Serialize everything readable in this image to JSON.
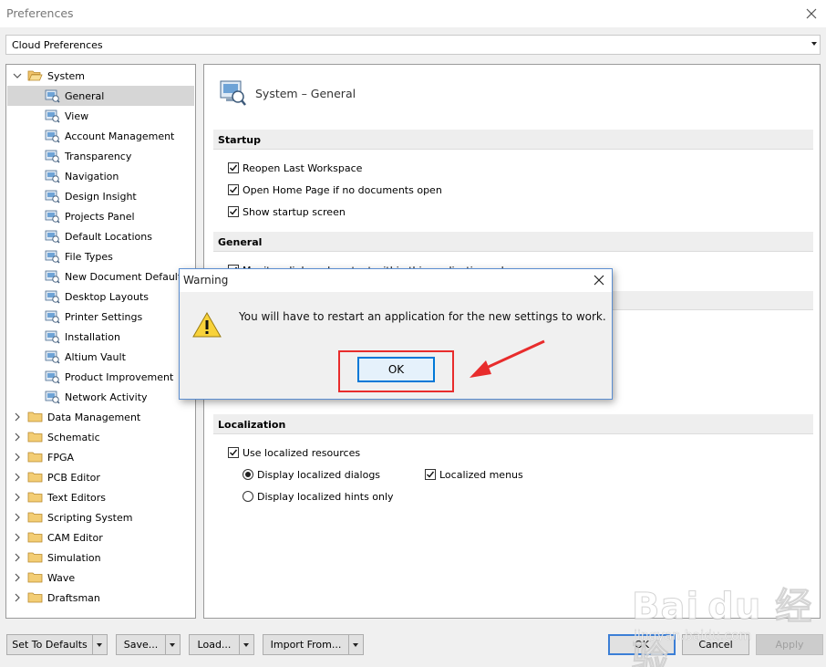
{
  "window": {
    "title": "Preferences"
  },
  "profile_select": {
    "value": "Cloud Preferences"
  },
  "tree": {
    "items": [
      {
        "label": "System",
        "level": 0,
        "expanded": true,
        "selected": false
      },
      {
        "label": "General",
        "level": 1,
        "selected": true
      },
      {
        "label": "View",
        "level": 1
      },
      {
        "label": "Account Management",
        "level": 1
      },
      {
        "label": "Transparency",
        "level": 1
      },
      {
        "label": "Navigation",
        "level": 1
      },
      {
        "label": "Design Insight",
        "level": 1
      },
      {
        "label": "Projects Panel",
        "level": 1
      },
      {
        "label": "Default Locations",
        "level": 1
      },
      {
        "label": "File Types",
        "level": 1
      },
      {
        "label": "New Document Defaults",
        "level": 1
      },
      {
        "label": "Desktop Layouts",
        "level": 1
      },
      {
        "label": "Printer Settings",
        "level": 1
      },
      {
        "label": "Installation",
        "level": 1
      },
      {
        "label": "Altium Vault",
        "level": 1
      },
      {
        "label": "Product Improvement",
        "level": 1
      },
      {
        "label": "Network Activity",
        "level": 1
      },
      {
        "label": "Data Management",
        "level": 0,
        "expanded": false
      },
      {
        "label": "Schematic",
        "level": 0,
        "expanded": false
      },
      {
        "label": "FPGA",
        "level": 0,
        "expanded": false
      },
      {
        "label": "PCB Editor",
        "level": 0,
        "expanded": false
      },
      {
        "label": "Text Editors",
        "level": 0,
        "expanded": false
      },
      {
        "label": "Scripting System",
        "level": 0,
        "expanded": false
      },
      {
        "label": "CAM Editor",
        "level": 0,
        "expanded": false
      },
      {
        "label": "Simulation",
        "level": 0,
        "expanded": false
      },
      {
        "label": "Wave",
        "level": 0,
        "expanded": false
      },
      {
        "label": "Draftsman",
        "level": 0,
        "expanded": false
      }
    ]
  },
  "content": {
    "page_title": "System – General",
    "startup": {
      "heading": "Startup",
      "reopen_last_workspace": "Reopen Last Workspace",
      "open_home_page": "Open Home Page if no documents open",
      "show_startup_screen": "Show startup screen"
    },
    "general": {
      "heading": "General",
      "monitor_clipboard": "Monitor clipboard content within this application only"
    },
    "localization": {
      "heading": "Localization",
      "use_localized_resources": "Use localized resources",
      "display_localized_dialogs": "Display localized dialogs",
      "localized_menus": "Localized menus",
      "display_localized_hints": "Display localized hints only"
    }
  },
  "buttons": {
    "set_to_defaults": "Set To Defaults",
    "save": "Save...",
    "load": "Load...",
    "import_from": "Import From...",
    "ok": "OK",
    "cancel": "Cancel",
    "apply": "Apply"
  },
  "warning_dialog": {
    "title": "Warning",
    "message": "You will have to restart an application for the new settings to work.",
    "ok": "OK"
  },
  "watermark": {
    "brand": "Bai du 经验",
    "url": "jingyan.baidu.com"
  },
  "colors": {
    "accent": "#0078d7",
    "annotation_red": "#e82c2c",
    "selection": "#d6d6d6"
  }
}
